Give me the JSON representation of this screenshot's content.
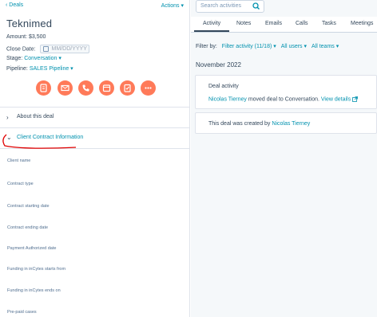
{
  "left": {
    "back_label": "‹ Deals",
    "actions_label": "Actions ▾",
    "deal_name": "Teknimed",
    "amount_text": "Amount: $3,500",
    "close_date_label": "Close Date:",
    "close_date_placeholder": "MM/DD/YYYY",
    "stage_label": "Stage:",
    "stage_value": "Conversation ▾",
    "pipeline_label": "Pipeline:",
    "pipeline_value": "SALES Pipeline ▾",
    "action_icons": [
      "note-icon",
      "email-icon",
      "call-icon",
      "meeting-icon",
      "task-icon",
      "more-icon"
    ],
    "about_section": "About this deal",
    "client_section": "Client Contract Information",
    "fields": [
      "Client name",
      "Contract type",
      "Contract starting date",
      "Contract ending date",
      "Payment Authorized date",
      "Funding in inCytes starts from",
      "Funding in inCytes ends on",
      "Pre-paid cases"
    ],
    "accent_color": "#ff7a59",
    "annotation_color": "#e00000"
  },
  "right": {
    "search_placeholder": "Search activities",
    "tabs": [
      "Activity",
      "Notes",
      "Emails",
      "Calls",
      "Tasks",
      "Meetings"
    ],
    "filter_label": "Filter by:",
    "filter_activity": "Filter activity (11/18) ▾",
    "all_users": "All users ▾",
    "all_teams": "All teams ▾",
    "month": "November 2022",
    "deal_activity_title": "Deal activity",
    "deal_activity_user": "Nicolas Tierney",
    "deal_activity_text": "moved deal to Conversation.",
    "view_details": "View details",
    "created_text": "This deal was created by",
    "created_user": "Nicolas Tierney",
    "link_color": "#0091ae"
  }
}
